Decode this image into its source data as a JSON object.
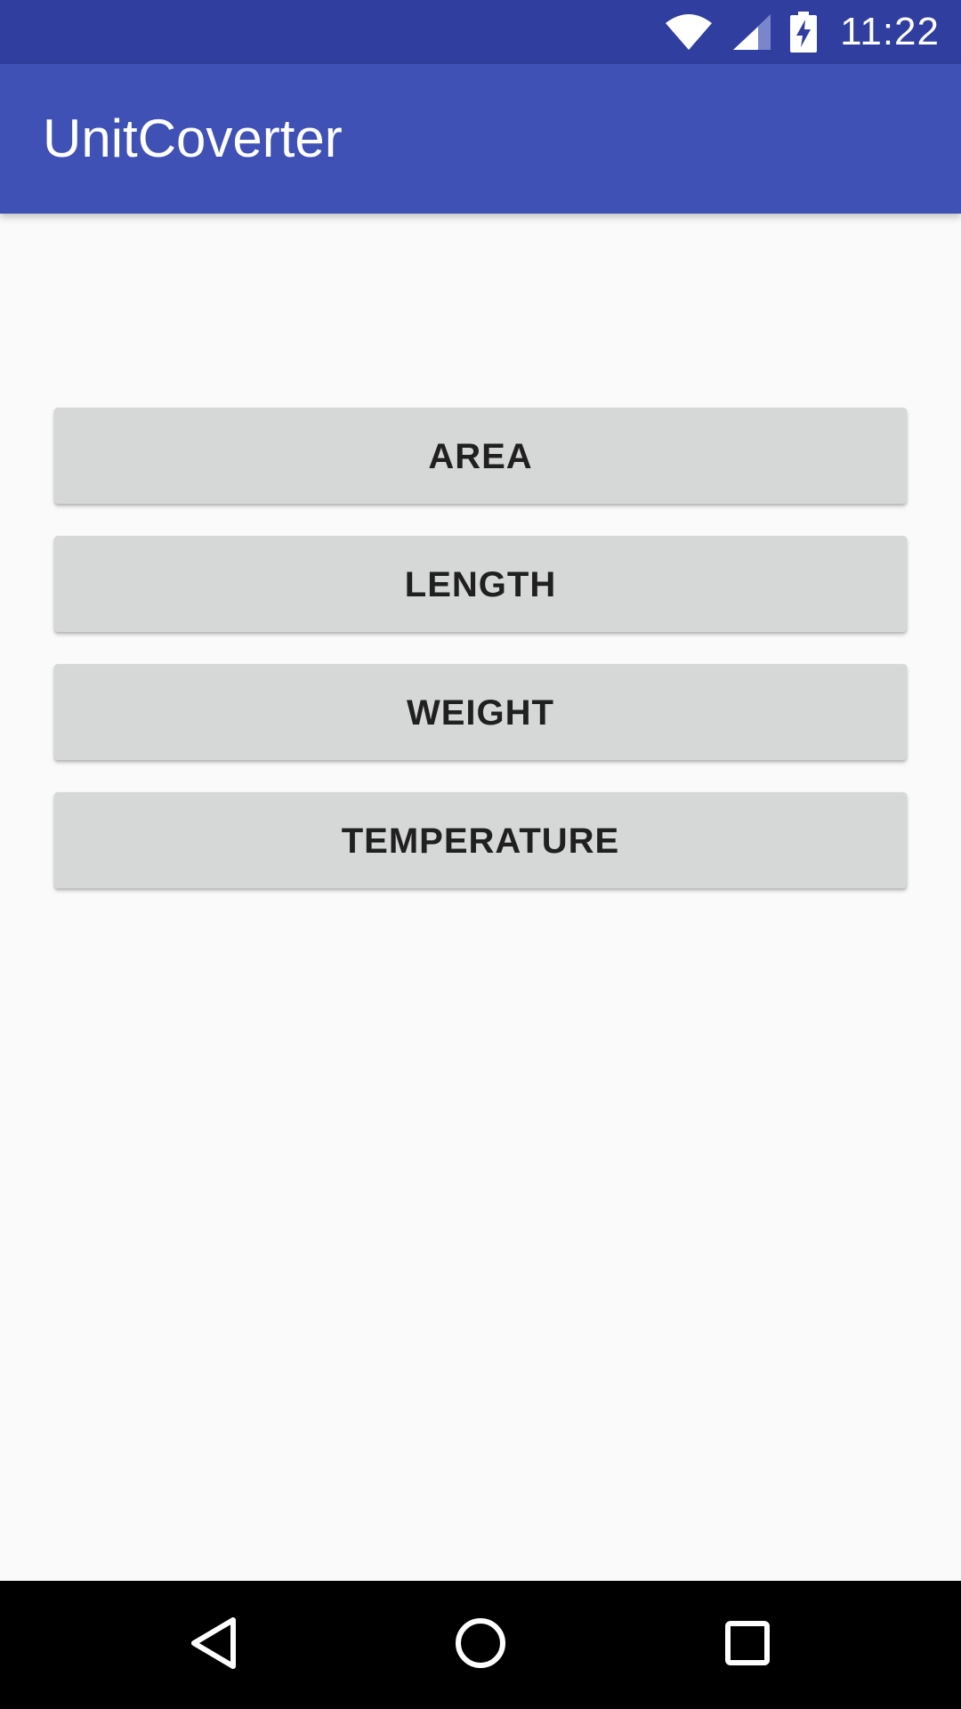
{
  "status_bar": {
    "time": "11:22",
    "icons": [
      "wifi-icon",
      "cellular-signal-icon",
      "battery-charging-icon"
    ],
    "background": "#303f9f"
  },
  "app_bar": {
    "title": "UnitCoverter",
    "background": "#3f51b5"
  },
  "main": {
    "buttons": [
      {
        "label": "AREA"
      },
      {
        "label": "LENGTH"
      },
      {
        "label": "WEIGHT"
      },
      {
        "label": "TEMPERATURE"
      }
    ],
    "button_color": "#d6d7d7"
  },
  "nav_bar": {
    "icons": [
      "back-icon",
      "home-icon",
      "recents-icon"
    ],
    "background": "#000000"
  }
}
